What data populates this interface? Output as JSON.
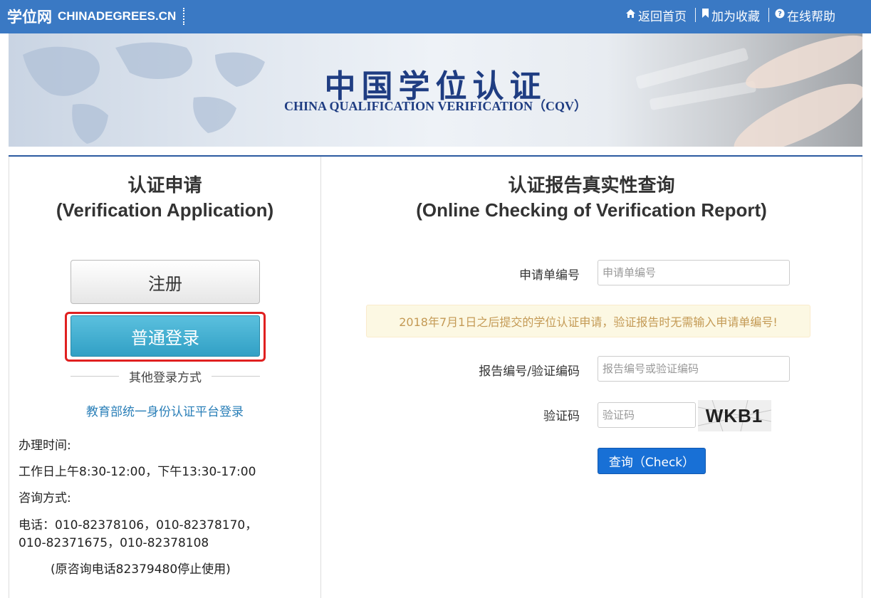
{
  "topbar": {
    "brand_cn": "学位网",
    "brand_en": "CHINADEGREES.CN",
    "links": [
      {
        "label": "返回首页",
        "icon": "home-icon"
      },
      {
        "label": "加为收藏",
        "icon": "bookmark-icon"
      },
      {
        "label": "在线帮助",
        "icon": "help-icon"
      }
    ]
  },
  "banner": {
    "title": "中国学位认证",
    "subtitle": "CHINA QUALIFICATION VERIFICATION（CQV）"
  },
  "left": {
    "title_cn": "认证申请",
    "title_en": "(Verification Application)",
    "register_label": "注册",
    "login_label": "普通登录",
    "other_login": "其他登录方式",
    "moe_link": "教育部统一身份认证平台登录",
    "hours_heading": "办理时间:",
    "hours_text": "工作日上午8:30-12:00，下午13:30-17:00",
    "contact_heading": "咨询方式:",
    "phone_text": "电话：010-82378106，010-82378170，010-82371675，010-82378108",
    "old_phone_text": "(原咨询电话82379480停止使用)"
  },
  "right": {
    "title_cn": "认证报告真实性查询",
    "title_en": "(Online Checking of Verification Report)",
    "app_no_label": "申请单编号",
    "app_no_placeholder": "申请单编号",
    "notice": "2018年7月1日之后提交的学位认证申请，验证报告时无需输入申请单编号!",
    "report_no_label": "报告编号/验证编码",
    "report_no_placeholder": "报告编号或验证编码",
    "captcha_label": "验证码",
    "captcha_placeholder": "验证码",
    "captcha_text": "WKB1",
    "check_label": "查询（Check）"
  },
  "colors": {
    "topbar": "#3a79c4",
    "login_button": "#31a0c5",
    "check_button": "#1870d6",
    "highlight": "#e02020"
  }
}
